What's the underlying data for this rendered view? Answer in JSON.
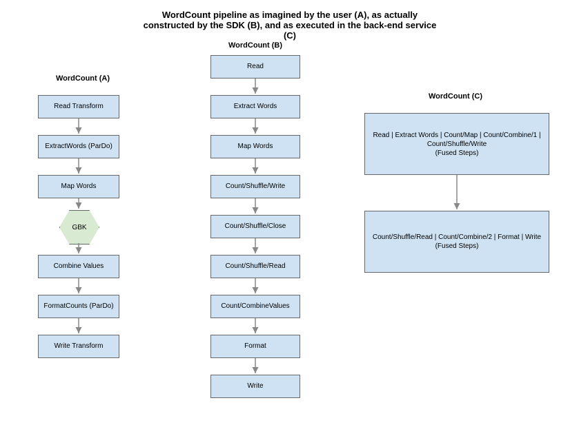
{
  "title": "WordCount pipeline as imagined by the user (A), as actually constructed by the SDK (B), and as executed in the back-end service (C)",
  "headings": {
    "a": "WordCount (A)",
    "b": "WordCount (B)",
    "c": "WordCount (C)"
  },
  "colA": [
    "Read Transform",
    "ExtractWords (ParDo)",
    "Map Words",
    "GBK",
    "Combine Values",
    "FormatCounts (ParDo)",
    "Write Transform"
  ],
  "colB": [
    "Read",
    "Extract Words",
    "Map Words",
    "Count/Shuffle/Write",
    "Count/Shuffle/Close",
    "Count/Shuffle/Read",
    "Count/CombineValues",
    "Format",
    "Write"
  ],
  "colC": [
    {
      "line1": "Read | Extract Words | Count/Map | Count/Combine/1 | Count/Shuffle/Write",
      "line2": "(Fused Steps)"
    },
    {
      "line1": "Count/Shuffle/Read | Count/Combine/2 | Format | Write",
      "line2": "(Fused Steps)"
    }
  ]
}
